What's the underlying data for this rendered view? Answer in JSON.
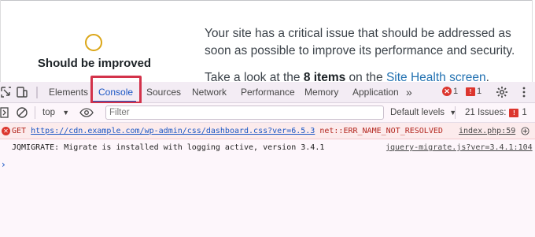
{
  "site_health": {
    "status_label": "Should be improved",
    "message": "Your site has a critical issue that should be addressed as soon as possible to improve its performance and security.",
    "take_look_prefix": "Take a look at the ",
    "items_count": "8 items",
    "on_the": " on the ",
    "link_text": "Site Health screen",
    "suffix": "."
  },
  "devtools": {
    "tabs": [
      {
        "label": "Elements"
      },
      {
        "label": "Console",
        "active": true
      },
      {
        "label": "Sources"
      },
      {
        "label": "Network"
      },
      {
        "label": "Performance"
      },
      {
        "label": "Memory"
      },
      {
        "label": "Application"
      }
    ],
    "more_tabs": "»",
    "error_count": "1",
    "warning_count": "1",
    "context_select": "top",
    "filter_placeholder": "Filter",
    "levels_select": "Default levels",
    "issues_label": "21 Issues:",
    "issues_count": "1",
    "colors": {
      "active_tab": "#1a56c4",
      "error": "#dc362e",
      "highlight": "#d3324a"
    }
  },
  "console": {
    "error": {
      "method": "GET ",
      "url": "https://cdn.example.com/wp-admin/css/dashboard.css?ver=6.5.3",
      "message": " net::ERR_NAME_NOT_RESOLVED",
      "source": "index.php:59"
    },
    "info": {
      "message": "JQMIGRATE: Migrate is installed with logging active, version 3.4.1",
      "source": "jquery-migrate.js?ver=3.4.1:104"
    },
    "prompt_symbol": "›"
  }
}
